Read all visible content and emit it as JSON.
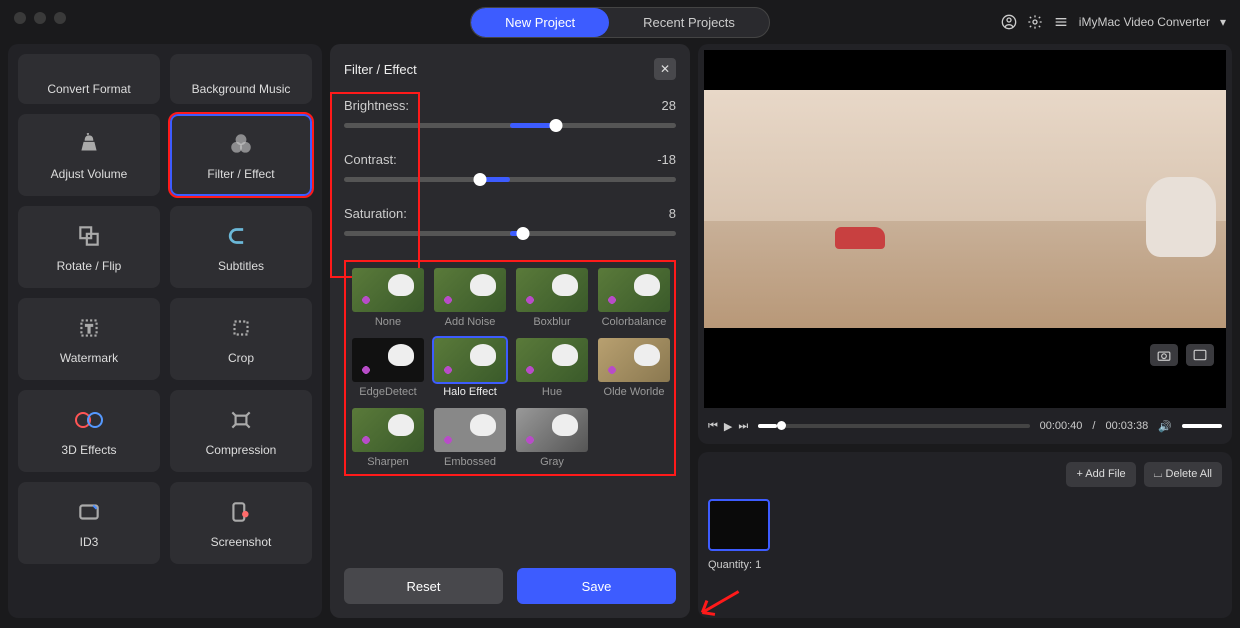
{
  "app_name": "iMyMac Video Converter",
  "tabs": {
    "new": "New Project",
    "recent": "Recent Projects"
  },
  "sidebar": {
    "items": [
      {
        "label": "Convert Format"
      },
      {
        "label": "Background Music"
      },
      {
        "label": "Adjust Volume"
      },
      {
        "label": "Filter / Effect"
      },
      {
        "label": "Rotate / Flip"
      },
      {
        "label": "Subtitles"
      },
      {
        "label": "Watermark"
      },
      {
        "label": "Crop"
      },
      {
        "label": "3D Effects"
      },
      {
        "label": "Compression"
      },
      {
        "label": "ID3"
      },
      {
        "label": "Screenshot"
      }
    ]
  },
  "filter_panel": {
    "title": "Filter / Effect",
    "sliders": {
      "brightness": {
        "label": "Brightness:",
        "value": "28",
        "percent": 64
      },
      "contrast": {
        "label": "Contrast:",
        "value": "-18",
        "percent": 41
      },
      "saturation": {
        "label": "Saturation:",
        "value": "8",
        "percent": 54
      }
    },
    "filters": [
      "None",
      "Add Noise",
      "Boxblur",
      "Colorbalance",
      "EdgeDetect",
      "Halo Effect",
      "Hue",
      "Olde Worlde",
      "Sharpen",
      "Embossed",
      "Gray"
    ],
    "selected_filter": "Halo Effect",
    "reset": "Reset",
    "save": "Save"
  },
  "player": {
    "current": "00:00:40",
    "total": "00:03:38"
  },
  "queue": {
    "add_file": "+ Add File",
    "delete_all": "⌴ Delete All",
    "quantity_label": "Quantity: ",
    "quantity_value": "1"
  }
}
